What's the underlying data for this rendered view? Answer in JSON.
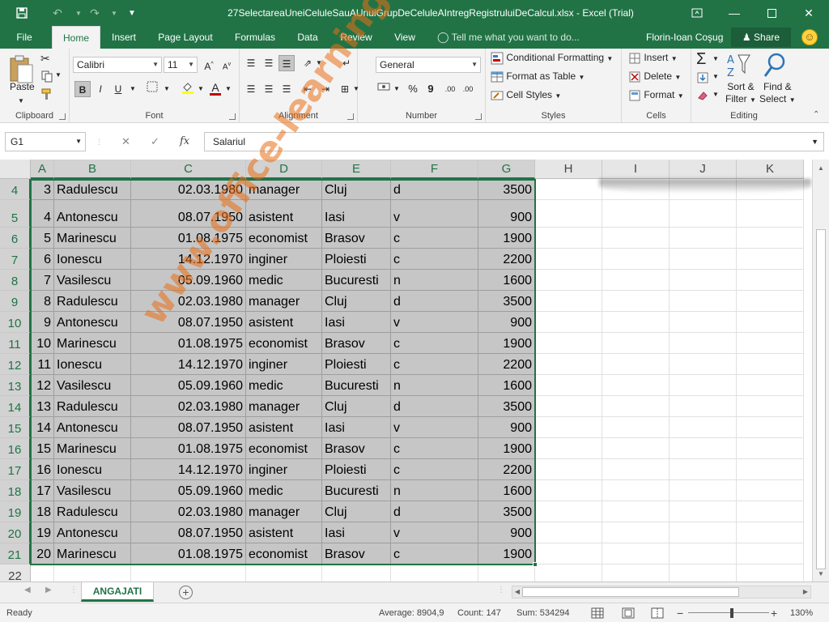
{
  "title": "27SelectareaUneiCeluleSauAUnuiGrupDeCeluleAIntregRegistruluiDeCalcul.xlsx - Excel (Trial)",
  "quick_access": {
    "save_icon": "save-icon",
    "undo_icon": "undo-icon",
    "redo_icon": "redo-icon",
    "customize_icon": "customize-icon"
  },
  "window": {
    "restore_ribbon": "ribbon-display-icon",
    "minimize": "minimize-icon",
    "maximize": "maximize-icon",
    "close": "close-icon"
  },
  "tabs": [
    {
      "label": "File"
    },
    {
      "label": "Home"
    },
    {
      "label": "Insert"
    },
    {
      "label": "Page Layout"
    },
    {
      "label": "Formulas"
    },
    {
      "label": "Data"
    },
    {
      "label": "Review"
    },
    {
      "label": "View"
    }
  ],
  "tell_me": "Tell me what you want to do...",
  "user": "Florin-Ioan Coşug",
  "share": "Share",
  "ribbon": {
    "clipboard": {
      "label": "Clipboard",
      "paste": "Paste"
    },
    "font": {
      "label": "Font",
      "name": "Calibri",
      "size": "11",
      "bold": "B",
      "italic": "I",
      "underline": "U"
    },
    "alignment": {
      "label": "Alignment"
    },
    "number": {
      "label": "Number",
      "format": "General",
      "percent": "%",
      "comma": "9",
      "inc_dec": ".00"
    },
    "styles": {
      "label": "Styles",
      "conditional": "Conditional Formatting",
      "format_table": "Format as Table",
      "cell_styles": "Cell Styles"
    },
    "cells": {
      "label": "Cells",
      "insert": "Insert",
      "delete": "Delete",
      "format": "Format"
    },
    "editing": {
      "label": "Editing",
      "sort_filter_1": "Sort &",
      "sort_filter_2": "Filter",
      "find_select_1": "Find &",
      "find_select_2": "Select"
    }
  },
  "formula_bar": {
    "name_box": "G1",
    "formula": "Salariul",
    "fx": "fx"
  },
  "columns": [
    "A",
    "B",
    "C",
    "D",
    "E",
    "F",
    "G",
    "H",
    "I",
    "J",
    "K"
  ],
  "rows": [
    {
      "n": "4",
      "cells": [
        "3",
        "Radulescu",
        "02.03.1980",
        "manager",
        "Cluj",
        "d",
        "3500"
      ]
    },
    {
      "n": "5",
      "cells": [
        "4",
        "Antonescu",
        "08.07.1950",
        "asistent",
        "Iasi",
        "v",
        "900"
      ]
    },
    {
      "n": "6",
      "cells": [
        "5",
        "Marinescu",
        "01.08.1975",
        "economist",
        "Brasov",
        "c",
        "1900"
      ]
    },
    {
      "n": "7",
      "cells": [
        "6",
        "Ionescu",
        "14.12.1970",
        "inginer",
        "Ploiesti",
        "c",
        "2200"
      ]
    },
    {
      "n": "8",
      "cells": [
        "7",
        "Vasilescu",
        "05.09.1960",
        "medic",
        "Bucuresti",
        "n",
        "1600"
      ]
    },
    {
      "n": "9",
      "cells": [
        "8",
        "Radulescu",
        "02.03.1980",
        "manager",
        "Cluj",
        "d",
        "3500"
      ]
    },
    {
      "n": "10",
      "cells": [
        "9",
        "Antonescu",
        "08.07.1950",
        "asistent",
        "Iasi",
        "v",
        "900"
      ]
    },
    {
      "n": "11",
      "cells": [
        "10",
        "Marinescu",
        "01.08.1975",
        "economist",
        "Brasov",
        "c",
        "1900"
      ]
    },
    {
      "n": "12",
      "cells": [
        "11",
        "Ionescu",
        "14.12.1970",
        "inginer",
        "Ploiesti",
        "c",
        "2200"
      ]
    },
    {
      "n": "13",
      "cells": [
        "12",
        "Vasilescu",
        "05.09.1960",
        "medic",
        "Bucuresti",
        "n",
        "1600"
      ]
    },
    {
      "n": "14",
      "cells": [
        "13",
        "Radulescu",
        "02.03.1980",
        "manager",
        "Cluj",
        "d",
        "3500"
      ]
    },
    {
      "n": "15",
      "cells": [
        "14",
        "Antonescu",
        "08.07.1950",
        "asistent",
        "Iasi",
        "v",
        "900"
      ]
    },
    {
      "n": "16",
      "cells": [
        "15",
        "Marinescu",
        "01.08.1975",
        "economist",
        "Brasov",
        "c",
        "1900"
      ]
    },
    {
      "n": "17",
      "cells": [
        "16",
        "Ionescu",
        "14.12.1970",
        "inginer",
        "Ploiesti",
        "c",
        "2200"
      ]
    },
    {
      "n": "18",
      "cells": [
        "17",
        "Vasilescu",
        "05.09.1960",
        "medic",
        "Bucuresti",
        "n",
        "1600"
      ]
    },
    {
      "n": "19",
      "cells": [
        "18",
        "Radulescu",
        "02.03.1980",
        "manager",
        "Cluj",
        "d",
        "3500"
      ]
    },
    {
      "n": "20",
      "cells": [
        "19",
        "Antonescu",
        "08.07.1950",
        "asistent",
        "Iasi",
        "v",
        "900"
      ]
    },
    {
      "n": "21",
      "cells": [
        "20",
        "Marinescu",
        "01.08.1975",
        "economist",
        "Brasov",
        "c",
        "1900"
      ]
    }
  ],
  "next_row": "22",
  "watermark": "www.office-learning.ro",
  "sheet_tab": "ANGAJATI",
  "status": {
    "ready": "Ready",
    "average": "Average: 8904,9",
    "count": "Count: 147",
    "sum": "Sum: 534294",
    "zoom": "130%"
  },
  "colors": {
    "accent": "#217346",
    "selection": "#c6c6c6",
    "watermark": "#eb6e14"
  }
}
